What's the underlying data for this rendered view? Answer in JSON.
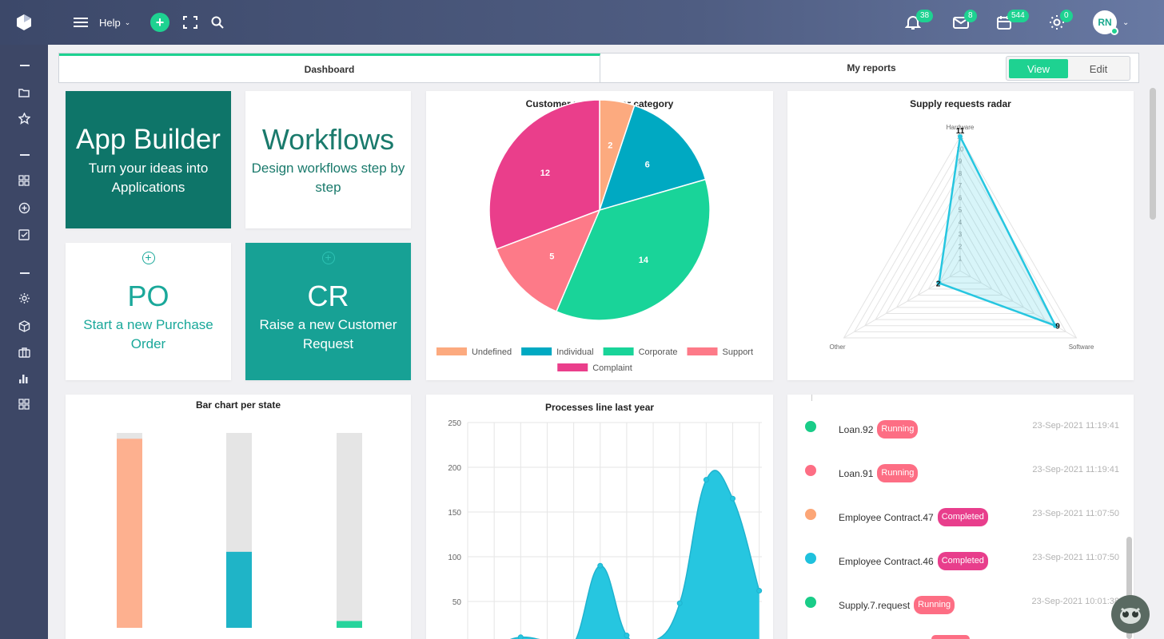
{
  "header": {
    "help_label": "Help",
    "notifications_count": "38",
    "messages_count": "8",
    "calendar_count": "544",
    "tasks_count": "0",
    "user_initials": "RN"
  },
  "sidebar": {
    "icons": [
      "folder-icon",
      "star-icon",
      "grid-icon",
      "plus-circle-icon",
      "checkbox-icon",
      "gear-icon",
      "cube-icon",
      "briefcase-icon",
      "bar-chart-icon",
      "apps-icon"
    ]
  },
  "tabs": {
    "dashboard": "Dashboard",
    "my_reports": "My reports",
    "view": "View",
    "edit": "Edit"
  },
  "tiles": {
    "app_builder": {
      "title": "App Builder",
      "subtitle": "Turn your ideas into Applications"
    },
    "workflows": {
      "title": "Workflows",
      "subtitle": "Design workflows step by step"
    },
    "po": {
      "title": "PO",
      "subtitle": "Start a new Purchase Order"
    },
    "cr": {
      "title": "CR",
      "subtitle": "Raise a new Customer Request"
    }
  },
  "colors": {
    "accent": "#1ed291",
    "teal_dark": "#0e7569",
    "teal": "#17a195",
    "title_teal": "#1a7a6c",
    "link_teal": "#1aa89a"
  },
  "chart_data": [
    {
      "type": "pie",
      "title": "Customer requests per category",
      "categories": [
        "Undefined",
        "Individual",
        "Corporate",
        "Support",
        "Complaint"
      ],
      "values": [
        2,
        6,
        14,
        5,
        12
      ],
      "colors": [
        "#fcaa7f",
        "#00a9c2",
        "#19d499",
        "#fd7a88",
        "#ea3e8b"
      ],
      "legend": "bottom"
    },
    {
      "type": "radar",
      "title": "Supply requests radar",
      "axes": [
        "Hardware",
        "Software",
        "Other"
      ],
      "values": [
        11,
        9,
        2
      ],
      "r_range": [
        1,
        11
      ],
      "ticks": [
        "1",
        "2",
        "3",
        "4",
        "5",
        "6",
        "7",
        "8",
        "9",
        "10",
        "11"
      ]
    },
    {
      "type": "bar",
      "title": "Bar chart per state",
      "series": [
        {
          "values": [
            0.97,
            0.39,
            0.035
          ],
          "colors": [
            "#fdb08f",
            "#1fb4c7",
            "#26d49c"
          ]
        }
      ],
      "background": "#e5e5e5"
    },
    {
      "type": "area",
      "title": "Processes line last year",
      "x": [
        1,
        2,
        3,
        4,
        5,
        6,
        7,
        8,
        9,
        10,
        11,
        12
      ],
      "values": [
        1,
        2,
        10,
        6,
        3,
        90,
        12,
        5,
        48,
        186,
        165,
        62
      ],
      "ylim": [
        0,
        250
      ],
      "yticks": [
        "250",
        "200",
        "150",
        "100",
        "50"
      ],
      "color": "#26c6e0",
      "grid": true
    }
  ],
  "activity": [
    {
      "name": "Loan.92",
      "status": "Running",
      "time": "23-Sep-2021 11:19:41",
      "dot": "#19cc88",
      "badge": "#fd6e84"
    },
    {
      "name": "Loan.91",
      "status": "Running",
      "time": "23-Sep-2021 11:19:41",
      "dot": "#fd6e84",
      "badge": "#fd6e84"
    },
    {
      "name": "Employee Contract.47",
      "status": "Completed",
      "time": "23-Sep-2021 11:07:50",
      "dot": "#fca677",
      "badge": "#e83e8c"
    },
    {
      "name": "Employee Contract.46",
      "status": "Completed",
      "time": "23-Sep-2021 11:07:50",
      "dot": "#1fc1dd",
      "badge": "#e83e8c"
    },
    {
      "name": "Supply.7.request",
      "status": "Running",
      "time": "23-Sep-2021 10:01:38",
      "dot": "#19cc88",
      "badge": "#fd6e84"
    }
  ]
}
